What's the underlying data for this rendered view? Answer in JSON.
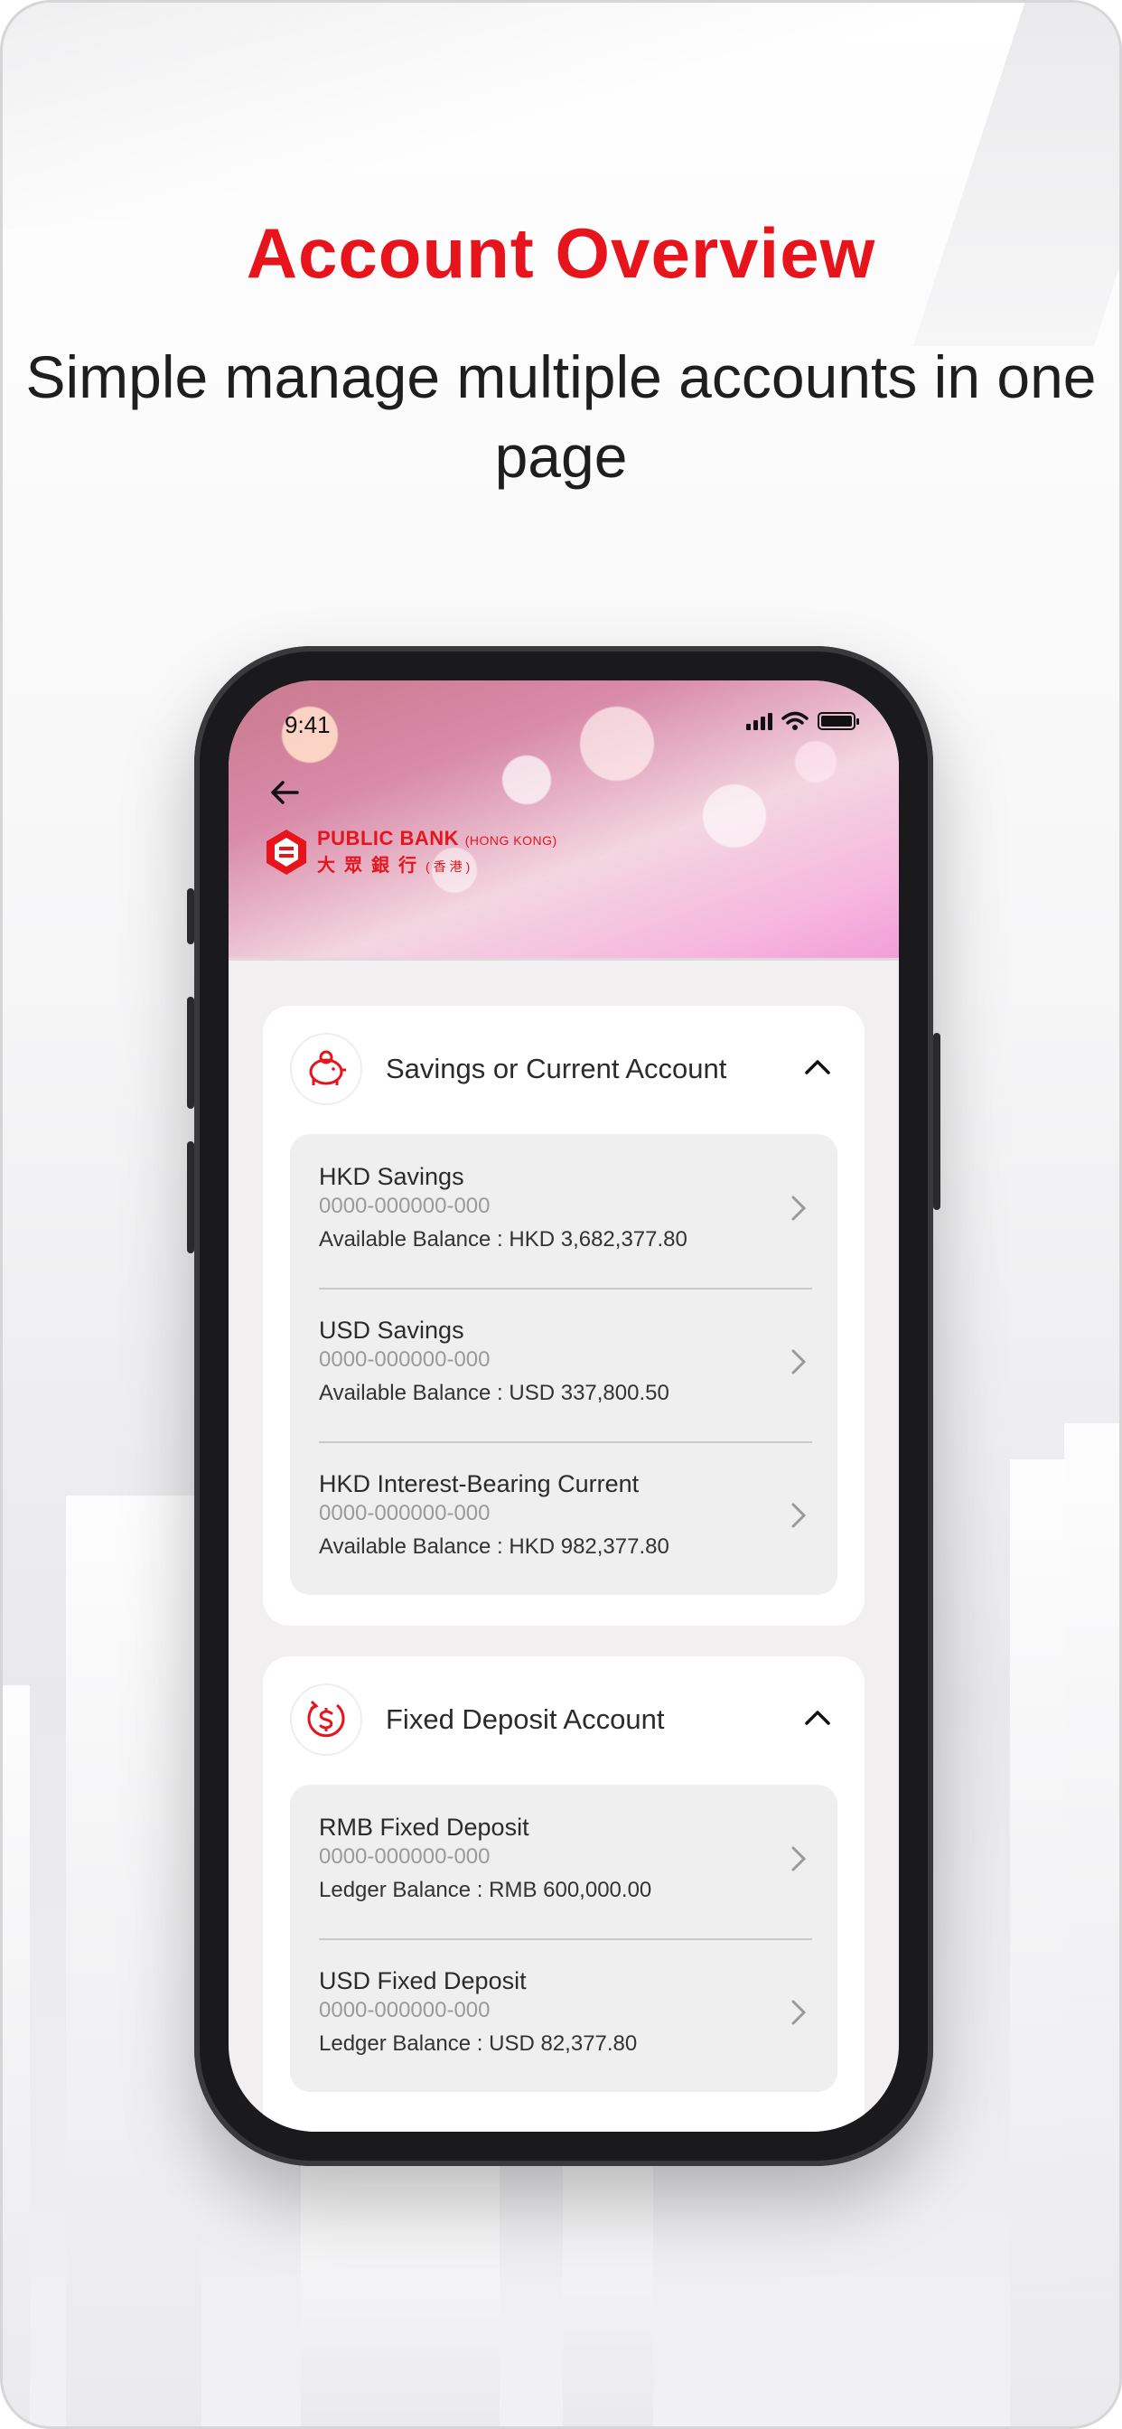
{
  "promo": {
    "headline": "Account Overview",
    "subheadline": "Simple manage multiple accounts in one page",
    "accent_color": "#e8141c"
  },
  "status_bar": {
    "time": "9:41",
    "icons": [
      "signal-icon",
      "wifi-icon",
      "battery-icon"
    ]
  },
  "header": {
    "back_icon": "back-arrow-icon",
    "bank_name_en": "PUBLIC BANK",
    "bank_region_en": "(HONG KONG)",
    "bank_name_zh": "大眾銀行",
    "bank_region_zh": "(香港)"
  },
  "sections": [
    {
      "title": "Savings or Current Account",
      "icon": "piggy-bank-icon",
      "expanded": true,
      "accounts": [
        {
          "name": "HKD Savings",
          "number": "0000-000000-000",
          "balance_label": "Available Balance :",
          "balance": "HKD 3,682,377.80"
        },
        {
          "name": "USD Savings",
          "number": "0000-000000-000",
          "balance_label": "Available Balance :",
          "balance": "USD 337,800.50"
        },
        {
          "name": "HKD Interest-Bearing Current",
          "number": "0000-000000-000",
          "balance_label": "Available Balance :",
          "balance": "HKD 982,377.80"
        }
      ]
    },
    {
      "title": "Fixed Deposit Account",
      "icon": "fixed-deposit-icon",
      "expanded": true,
      "accounts": [
        {
          "name": "RMB Fixed Deposit",
          "number": "0000-000000-000",
          "balance_label": "Ledger Balance :",
          "balance": "RMB 600,000.00"
        },
        {
          "name": "USD Fixed Deposit",
          "number": "0000-000000-000",
          "balance_label": "Ledger Balance :",
          "balance": "USD 82,377.80"
        }
      ]
    }
  ]
}
